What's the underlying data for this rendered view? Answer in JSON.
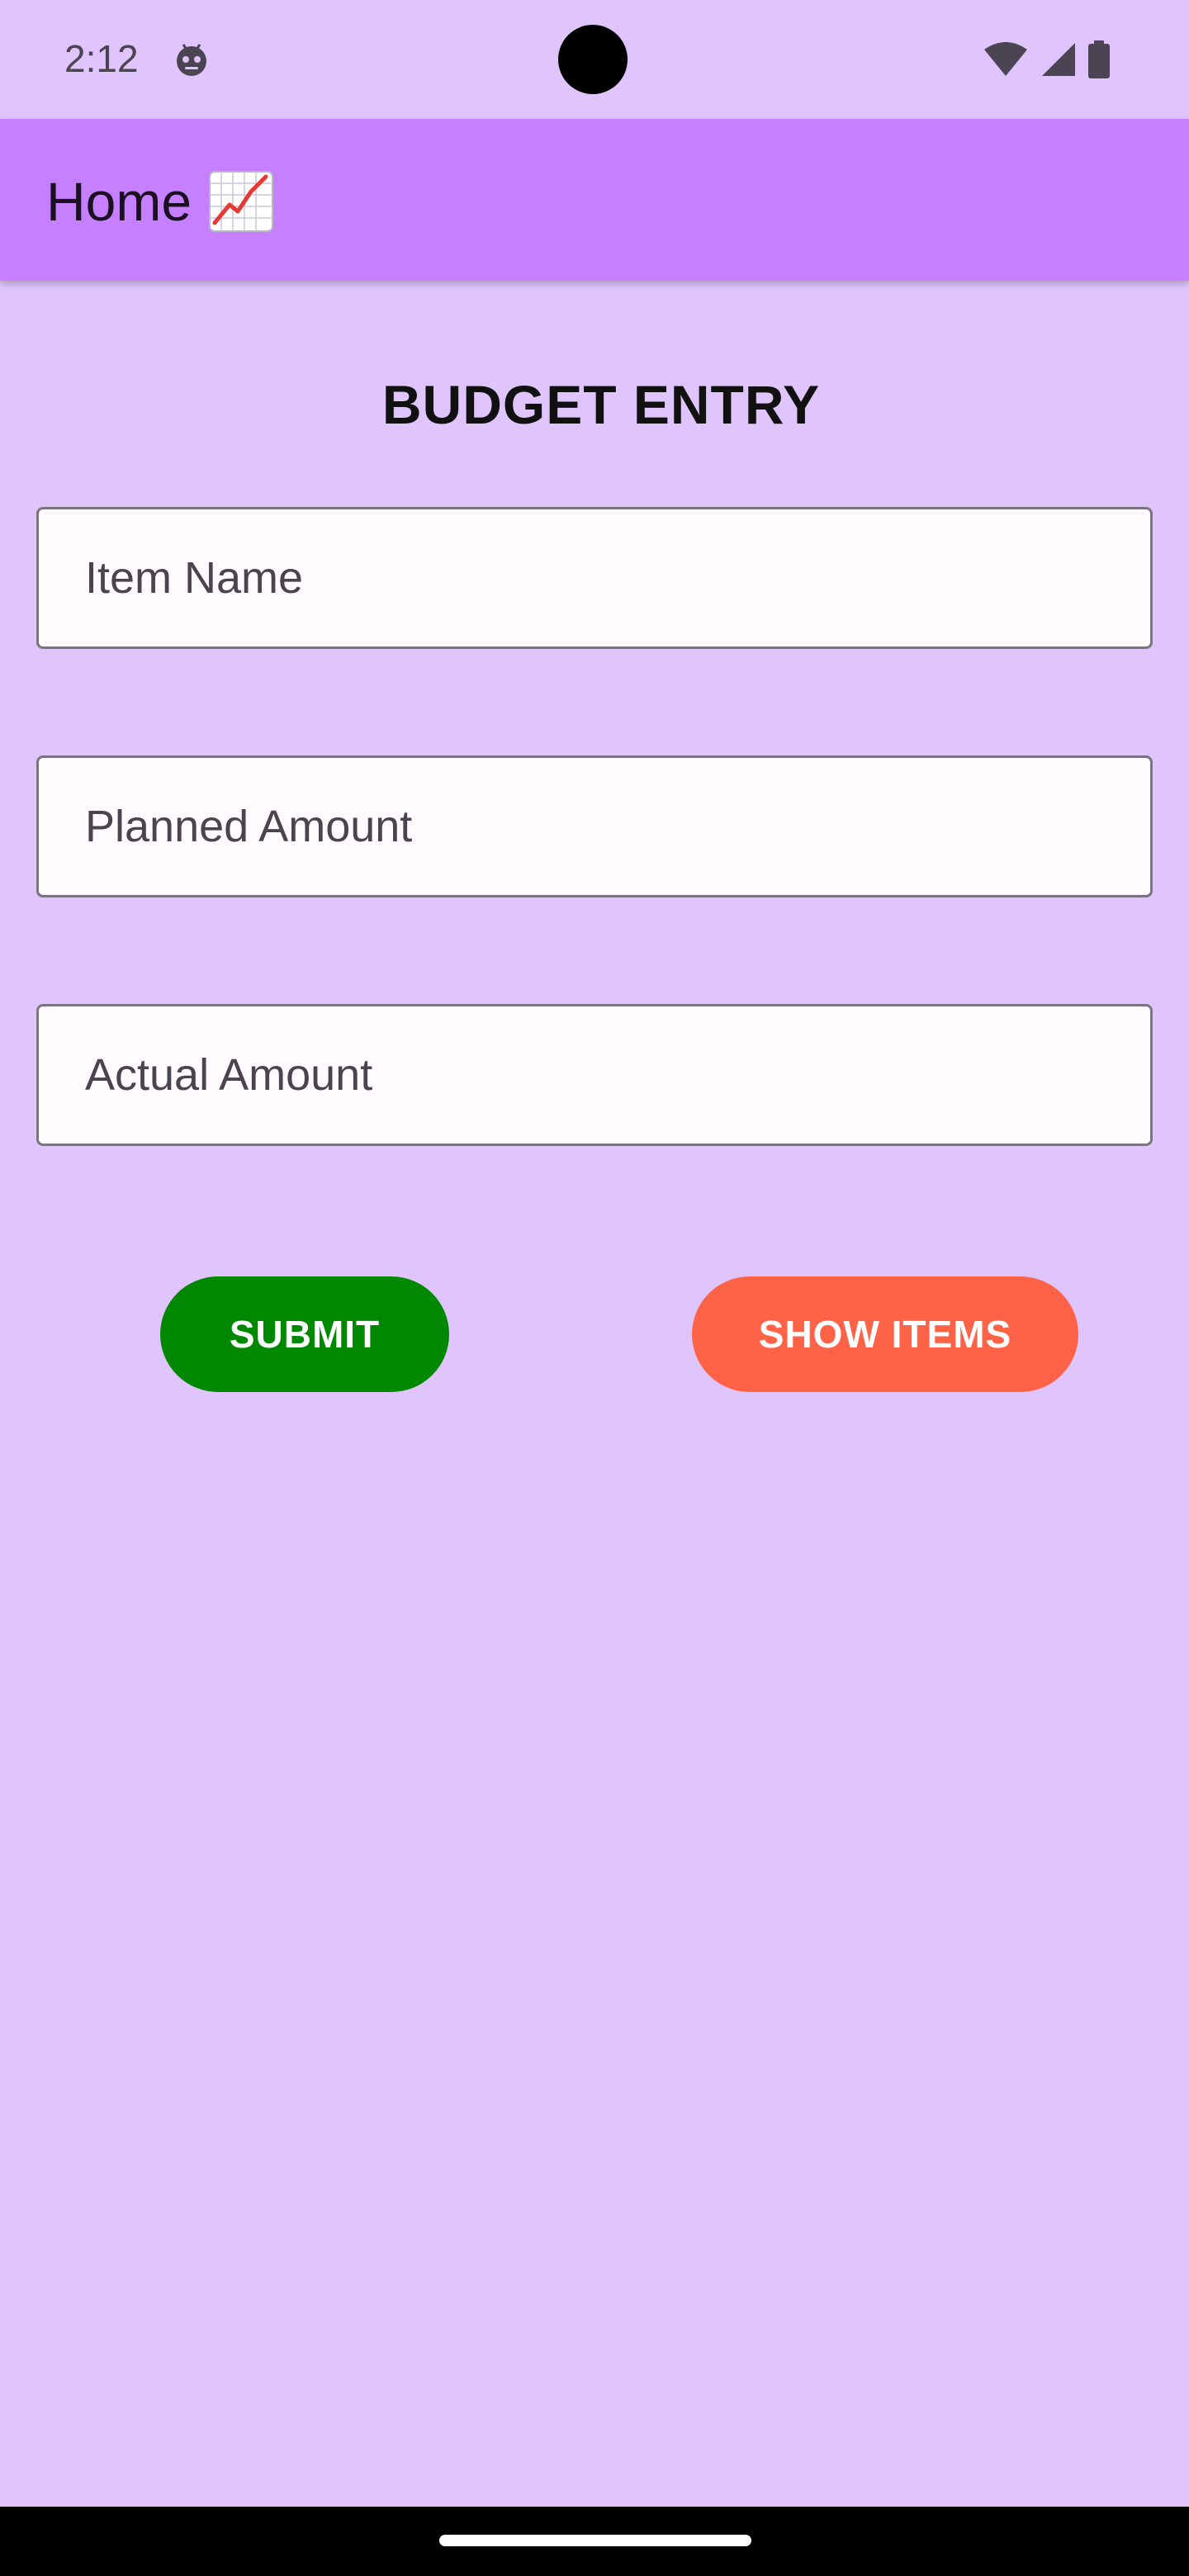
{
  "status_bar": {
    "time": "2:12",
    "icons": [
      "android-debug-icon",
      "wifi-icon",
      "cellular-signal-icon",
      "battery-icon"
    ]
  },
  "app_bar": {
    "title": "Home",
    "title_icon": "chart-increasing-icon",
    "background": "#C57FFF"
  },
  "form": {
    "heading": "BUDGET ENTRY",
    "fields": [
      {
        "placeholder": "Item Name",
        "value": ""
      },
      {
        "placeholder": "Planned Amount",
        "value": ""
      },
      {
        "placeholder": "Actual Amount",
        "value": ""
      }
    ]
  },
  "buttons": {
    "submit_label": "SUBMIT",
    "submit_color": "#008800",
    "show_items_label": "SHOW ITEMS",
    "show_items_color": "#FF6347"
  },
  "colors": {
    "background": "#E0C5FD"
  }
}
